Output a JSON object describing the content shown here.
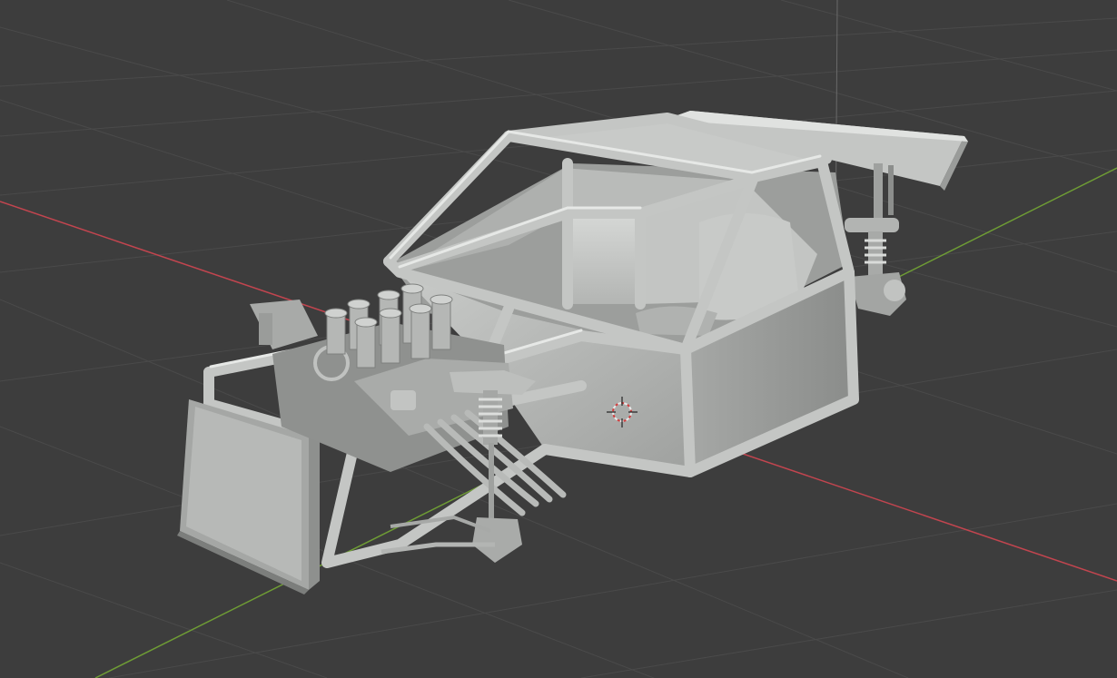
{
  "viewport": {
    "mode": "3d-viewport-solid-shading",
    "background_color": "#3d3d3d",
    "grid_color": "#4a4a4a",
    "x_axis_color": "#c2454f",
    "y_axis_color": "#6e9c35",
    "object_color": "#b8bab8"
  },
  "scene": {
    "object": "tube-frame-buggy-chassis",
    "parts": [
      "roll-cage",
      "side-panels",
      "seat",
      "engine",
      "intake-stacks",
      "radiator",
      "front-suspension",
      "rear-suspension",
      "rear-wing",
      "exhaust-pipes"
    ],
    "cursor": "3d-cursor"
  }
}
